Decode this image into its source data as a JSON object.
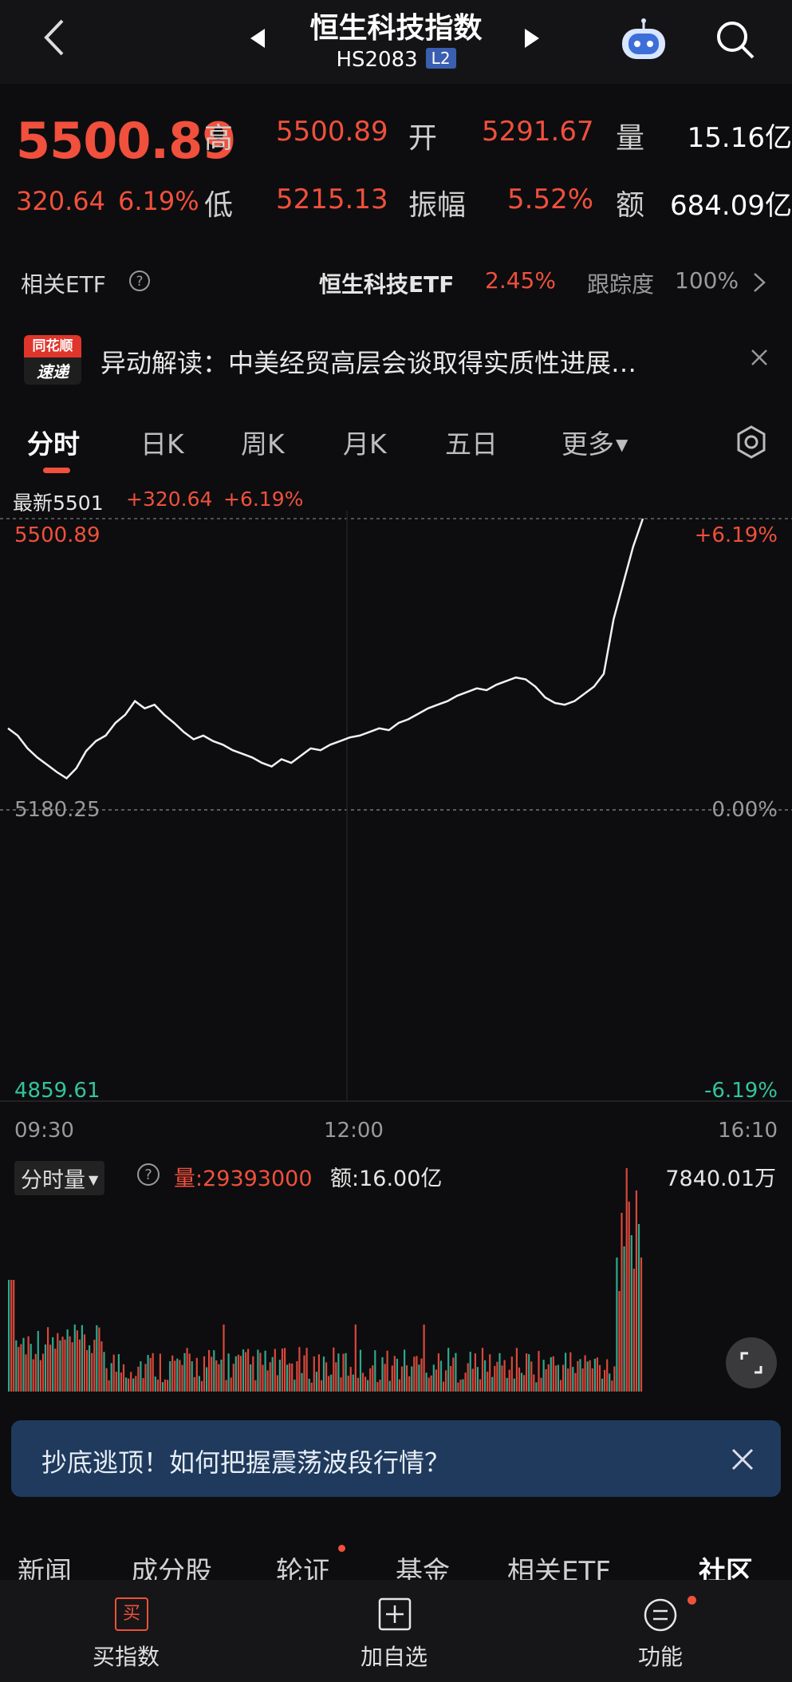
{
  "header": {
    "title": "恒生科技指数",
    "code": "HS2083",
    "level_badge": "L2",
    "icons": [
      "back-chevron-icon",
      "prev-arrow-icon",
      "next-arrow-icon",
      "robot-assistant-icon",
      "search-icon"
    ]
  },
  "quote": {
    "price": "5500.89",
    "change": "320.64",
    "change_pct": "6.19%",
    "high_label": "高",
    "high": "5500.89",
    "open_label": "开",
    "open": "5291.67",
    "volume_label": "量",
    "volume": "15.16亿",
    "low_label": "低",
    "low": "5215.13",
    "amplitude_label": "振幅",
    "amplitude": "5.52%",
    "amount_label": "额",
    "amount": "684.09亿"
  },
  "etf": {
    "label": "相关ETF",
    "name": "恒生科技ETF",
    "pct": "2.45%",
    "tracking_label": "跟踪度",
    "tracking": "100%"
  },
  "news": {
    "logo_top": "同花顺",
    "logo_bottom": "速递",
    "text": "异动解读：中美经贸高层会谈取得实质性进展…"
  },
  "tabs": [
    "分时",
    "日K",
    "周K",
    "月K",
    "五日",
    "更多"
  ],
  "chart_info": {
    "latest": "最新5501",
    "change": "+320.64",
    "pct": "+6.19%"
  },
  "chart_data": {
    "type": "line",
    "x": [
      "09:30",
      "12:00",
      "16:10"
    ],
    "y_left_ticks": [
      "5500.89",
      "5180.25",
      "4859.61"
    ],
    "y_right_ticks": [
      "+6.19%",
      "0.00%",
      "-6.19%"
    ],
    "ylim": [
      4859.61,
      5500.89
    ],
    "baseline": 5180.25,
    "series": [
      {
        "values": [
          5270,
          5262,
          5248,
          5238,
          5230,
          5222,
          5215,
          5226,
          5245,
          5256,
          5262,
          5276,
          5285,
          5300,
          5292,
          5296,
          5285,
          5276,
          5266,
          5258,
          5262,
          5256,
          5252,
          5246,
          5242,
          5238,
          5232,
          5228,
          5236,
          5232,
          5240,
          5248,
          5246,
          5252,
          5256,
          5260,
          5262,
          5266,
          5270,
          5268,
          5276,
          5280,
          5286,
          5292,
          5296,
          5300,
          5306,
          5310,
          5314,
          5312,
          5318,
          5322,
          5326,
          5324,
          5316,
          5304,
          5298,
          5296,
          5300,
          5308,
          5316,
          5330,
          5390,
          5430,
          5470,
          5500.89
        ]
      }
    ],
    "volume": {
      "title": "分时量",
      "vol_label": "量:29393000",
      "amount_label": "额:16.00亿",
      "max_label": "7840.01万"
    }
  },
  "promo": {
    "text": "抄底逃顶！如何把握震荡波段行情？"
  },
  "bottom_tabs": [
    "新闻",
    "成分股",
    "轮证",
    "基金",
    "相关ETF",
    "社区"
  ],
  "bottom_bar": [
    "买指数",
    "加自选",
    "功能"
  ],
  "bottom_bar_badge": "买"
}
